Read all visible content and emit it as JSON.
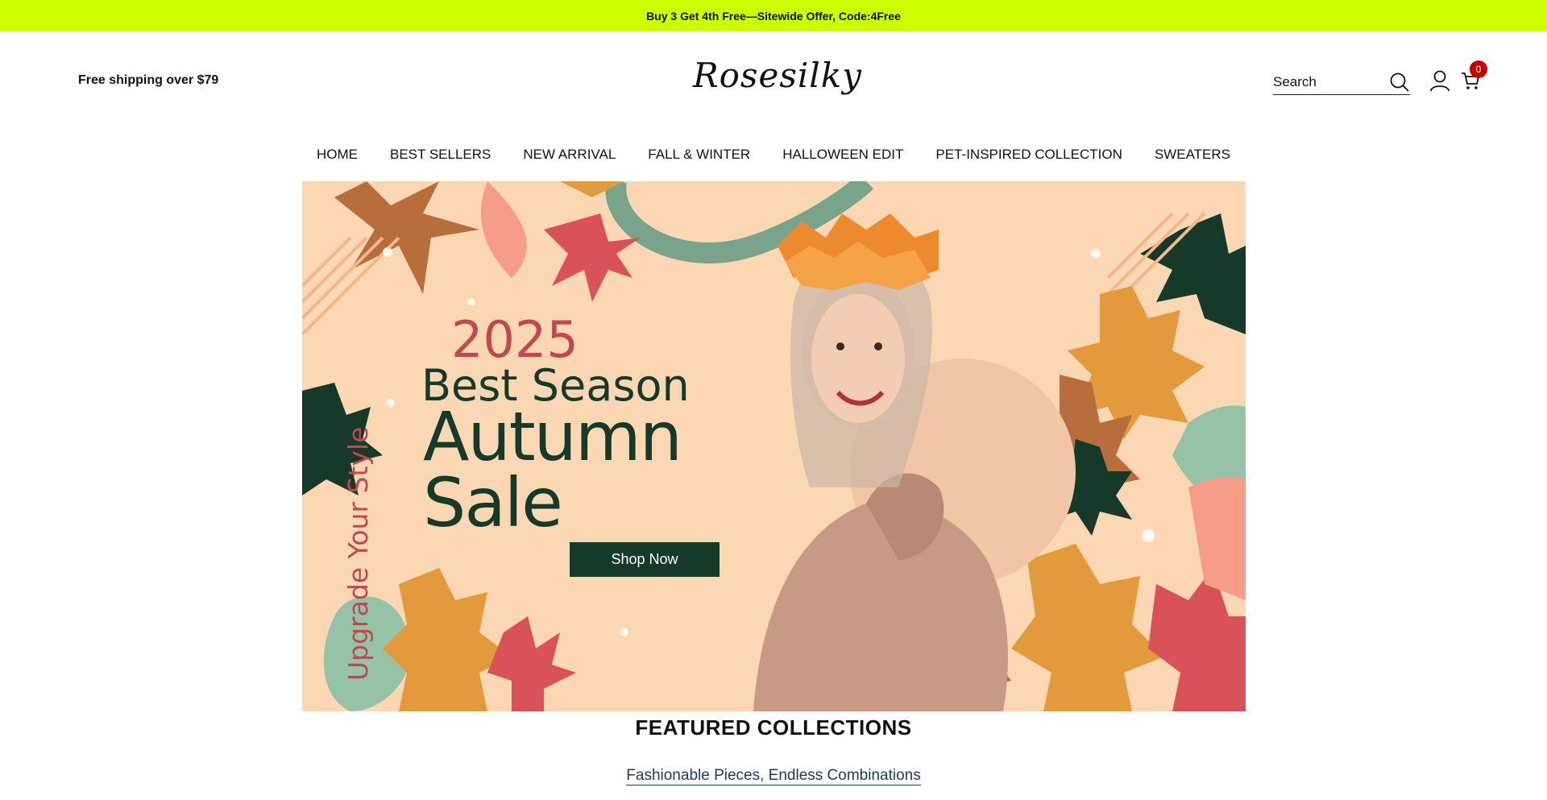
{
  "announcement": {
    "text": "Buy 3 Get 4th Free—Sitewide Offer, Code:4Free"
  },
  "header": {
    "free_shipping": "Free shipping over $79",
    "logo": "Rosesilky",
    "search_placeholder": "Search",
    "cart_count": "0"
  },
  "nav": {
    "items": [
      {
        "label": "HOME"
      },
      {
        "label": "BEST SELLERS"
      },
      {
        "label": "NEW ARRIVAL"
      },
      {
        "label": "FALL & WINTER"
      },
      {
        "label": "HALLOWEEN EDIT"
      },
      {
        "label": " PET-INSPIRED COLLECTION"
      },
      {
        "label": "SWEATERS"
      }
    ]
  },
  "hero": {
    "year": "2025",
    "line1": "Best Season",
    "line2": "Autumn",
    "line3": "Sale",
    "button": "Shop Now",
    "vertical_text": "Upgrade Your Style"
  },
  "featured": {
    "title": "FEATURED COLLECTIONS",
    "subtitle": "Fashionable Pieces, Endless Combinations"
  },
  "colors": {
    "announcement_bg": "#ccff00",
    "hero_bg": "#fcd7b4",
    "hero_dark_green": "#163a2a",
    "hero_red": "#c0484f",
    "cart_badge": "#c40000"
  }
}
